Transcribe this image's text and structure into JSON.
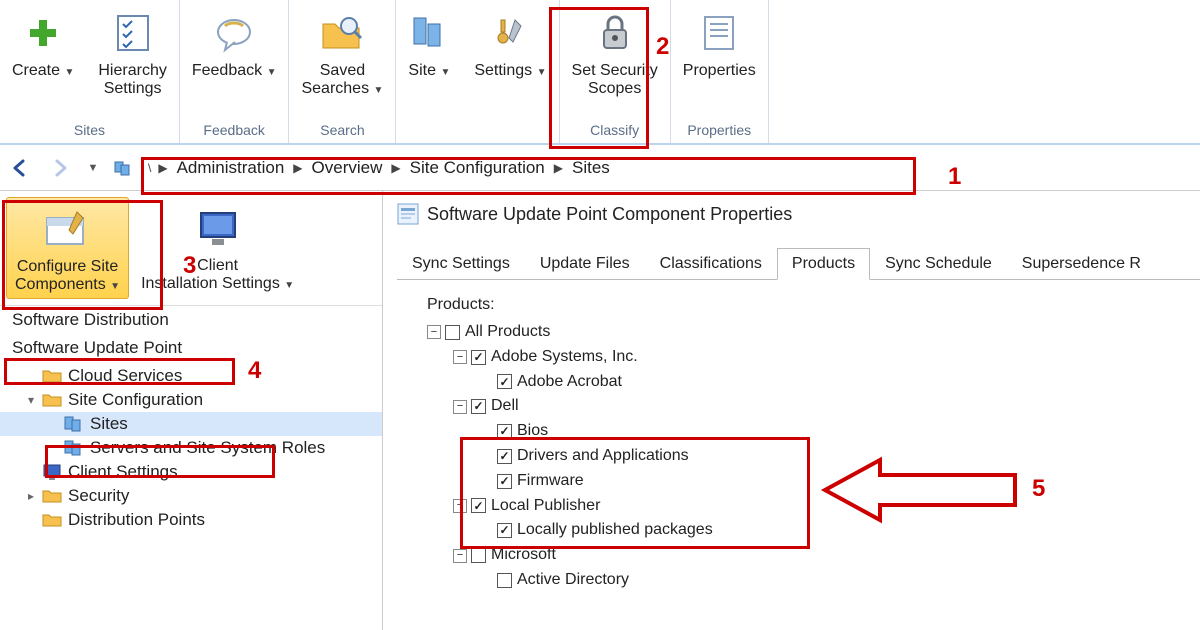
{
  "ribbon": {
    "groups": [
      {
        "label": "Sites",
        "buttons": [
          {
            "name": "create-button",
            "label": "Create",
            "dropdown": true,
            "icon": "plus"
          },
          {
            "name": "hierarchy-settings-button",
            "label": "Hierarchy\nSettings",
            "icon": "checklist"
          }
        ]
      },
      {
        "label": "Feedback",
        "buttons": [
          {
            "name": "feedback-button",
            "label": "Feedback",
            "dropdown": true,
            "icon": "feedback"
          }
        ]
      },
      {
        "label": "Search",
        "buttons": [
          {
            "name": "saved-searches-button",
            "label": "Saved\nSearches",
            "dropdown": true,
            "icon": "folder-search"
          }
        ]
      },
      {
        "label": "",
        "buttons": [
          {
            "name": "site-button",
            "label": "Site",
            "dropdown": true,
            "icon": "servers"
          },
          {
            "name": "settings-button",
            "label": "Settings",
            "dropdown": true,
            "icon": "tools"
          }
        ]
      },
      {
        "label": "Classify",
        "buttons": [
          {
            "name": "set-security-scopes-button",
            "label": "Set Security\nScopes",
            "icon": "lock"
          }
        ]
      },
      {
        "label": "Properties",
        "buttons": [
          {
            "name": "properties-button",
            "label": "Properties",
            "icon": "properties"
          }
        ]
      }
    ]
  },
  "breadcrumb": {
    "items": [
      "Administration",
      "Overview",
      "Site Configuration",
      "Sites"
    ]
  },
  "left_tools": [
    {
      "name": "configure-site-components-button",
      "label": "Configure Site\nComponents",
      "dropdown": true,
      "selected": true,
      "icon": "box-tools"
    },
    {
      "name": "client-installation-settings-button",
      "label": "Client\nInstallation Settings",
      "dropdown": true,
      "icon": "monitor"
    }
  ],
  "left_menu": [
    {
      "name": "menu-software-distribution",
      "label": "Software Distribution"
    },
    {
      "name": "menu-software-update-point",
      "label": "Software Update Point"
    }
  ],
  "nav_tree": [
    {
      "name": "tree-cloud-services",
      "label": "Cloud Services",
      "indent": 1,
      "icon": "folder",
      "arrow": ""
    },
    {
      "name": "tree-site-configuration",
      "label": "Site Configuration",
      "indent": 1,
      "icon": "folder",
      "arrow": "▾"
    },
    {
      "name": "tree-sites",
      "label": "Sites",
      "indent": 2,
      "icon": "servers",
      "selected": true,
      "arrow": ""
    },
    {
      "name": "tree-servers-roles",
      "label": "Servers and Site System Roles",
      "indent": 2,
      "icon": "servers",
      "arrow": ""
    },
    {
      "name": "tree-client-settings",
      "label": "Client Settings",
      "indent": 1,
      "icon": "monitor",
      "arrow": ""
    },
    {
      "name": "tree-security",
      "label": "Security",
      "indent": 1,
      "icon": "folder",
      "arrow": "▸"
    },
    {
      "name": "tree-distribution-points",
      "label": "Distribution Points",
      "indent": 1,
      "icon": "folder",
      "arrow": ""
    }
  ],
  "dialog": {
    "title": "Software Update Point Component Properties",
    "tabs": [
      "Sync Settings",
      "Update Files",
      "Classifications",
      "Products",
      "Sync Schedule",
      "Supersedence R"
    ],
    "active_tab": 3,
    "products_label": "Products:",
    "tree": [
      {
        "label": "All Products",
        "indent": 0,
        "toggle": "-",
        "checked": false
      },
      {
        "label": "Adobe Systems, Inc.",
        "indent": 1,
        "toggle": "-",
        "checked": true
      },
      {
        "label": "Adobe Acrobat",
        "indent": 2,
        "toggle": "",
        "checked": true
      },
      {
        "label": "Dell",
        "indent": 1,
        "toggle": "-",
        "checked": true
      },
      {
        "label": "Bios",
        "indent": 2,
        "toggle": "",
        "checked": true
      },
      {
        "label": "Drivers and Applications",
        "indent": 2,
        "toggle": "",
        "checked": true
      },
      {
        "label": "Firmware",
        "indent": 2,
        "toggle": "",
        "checked": true
      },
      {
        "label": "Local Publisher",
        "indent": 1,
        "toggle": "-",
        "checked": true
      },
      {
        "label": "Locally published packages",
        "indent": 2,
        "toggle": "",
        "checked": true
      },
      {
        "label": "Microsoft",
        "indent": 1,
        "toggle": "-",
        "checked": false
      },
      {
        "label": "Active Directory",
        "indent": 2,
        "toggle": "",
        "checked": false
      }
    ]
  },
  "annotations": {
    "1": "1",
    "2": "2",
    "3": "3",
    "4": "4",
    "5": "5"
  }
}
